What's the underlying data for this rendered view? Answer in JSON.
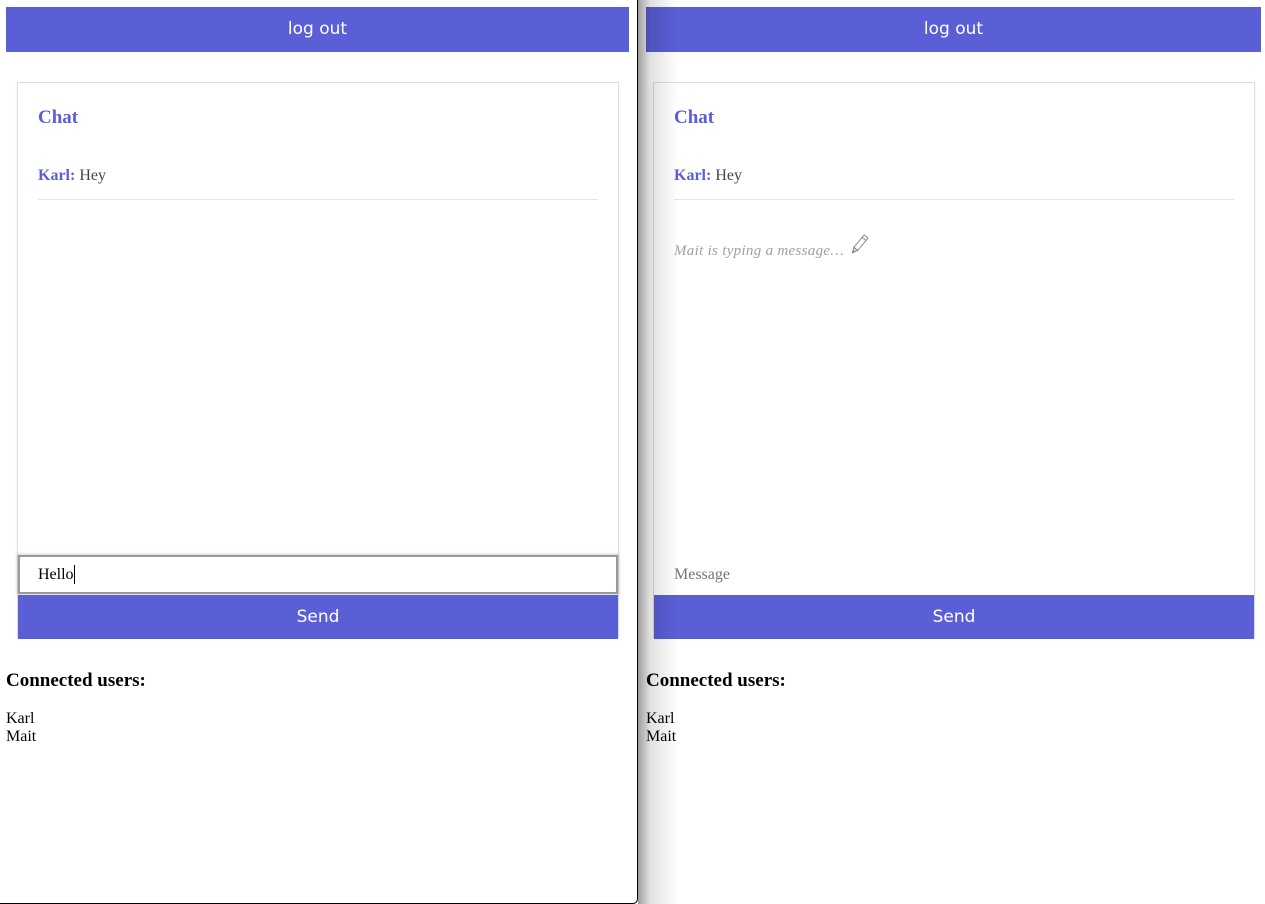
{
  "windows": [
    {
      "logout_label": "log out",
      "chat": {
        "title": "Chat",
        "messages": [
          {
            "author": "Karl:",
            "text": "Hey"
          }
        ],
        "input_value": "Hello",
        "input_placeholder": "Message",
        "send_label": "Send"
      },
      "users": {
        "title": "Connected users:",
        "list": [
          "Karl",
          "Mait"
        ]
      }
    },
    {
      "logout_label": "log out",
      "chat": {
        "title": "Chat",
        "messages": [
          {
            "author": "Karl:",
            "text": "Hey"
          }
        ],
        "typing_indicator": "Mait is typing a message…",
        "input_value": "",
        "input_placeholder": "Message",
        "send_label": "Send"
      },
      "users": {
        "title": "Connected users:",
        "list": [
          "Karl",
          "Mait"
        ]
      }
    }
  ],
  "colors": {
    "accent": "#5a5fd6",
    "typing_text": "#a0a0a0"
  },
  "icons": {
    "typing": "pencil-icon"
  }
}
